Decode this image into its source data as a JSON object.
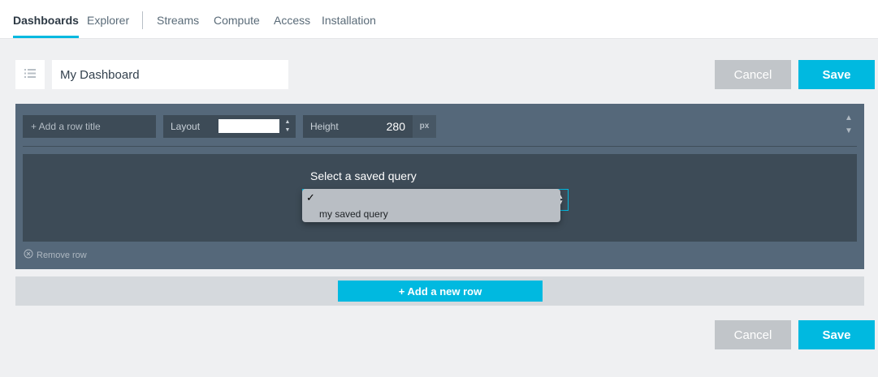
{
  "nav": {
    "items": [
      {
        "label": "Dashboards",
        "active": true
      },
      {
        "label": "Explorer",
        "active": false
      },
      {
        "label": "Streams",
        "active": false
      },
      {
        "label": "Compute",
        "active": false
      },
      {
        "label": "Access",
        "active": false
      },
      {
        "label": "Installation",
        "active": false
      }
    ]
  },
  "dashboard": {
    "title": "My Dashboard",
    "cancel_label": "Cancel",
    "save_label": "Save"
  },
  "row": {
    "title_placeholder": "+ Add a row title",
    "layout_label": "Layout",
    "layout_value": "",
    "height_label": "Height",
    "height_value": "280",
    "height_unit": "px",
    "query_label": "Select a saved query",
    "query_selected": "",
    "query_options": [
      "",
      "my saved query"
    ],
    "remove_label": "Remove row"
  },
  "add_row_label": "+ Add a new row",
  "footer": {
    "cancel_label": "Cancel",
    "save_label": "Save"
  },
  "colors": {
    "accent": "#00b9e0",
    "row_panel": "#55687a",
    "row_field": "#3d4b57",
    "cancel": "#c1c5c9"
  },
  "icons": {
    "menu": "list-icon",
    "check": "checkmark-icon",
    "remove": "circle-x-icon",
    "reorder": "up-down-arrows-icon"
  }
}
